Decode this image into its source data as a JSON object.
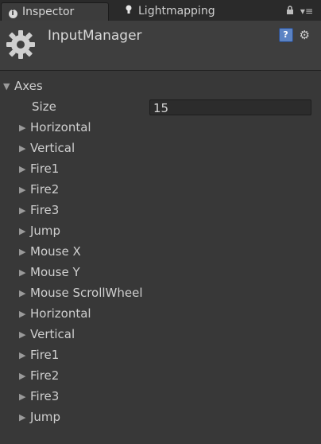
{
  "tabs": [
    {
      "label": "Inspector",
      "icon": "info-icon"
    },
    {
      "label": "Lightmapping",
      "icon": "lightbulb-icon"
    }
  ],
  "header": {
    "title": "InputManager"
  },
  "axes": {
    "label": "Axes",
    "size_label": "Size",
    "size_value": "15",
    "items": [
      "Horizontal",
      "Vertical",
      "Fire1",
      "Fire2",
      "Fire3",
      "Jump",
      "Mouse X",
      "Mouse Y",
      "Mouse ScrollWheel",
      "Horizontal",
      "Vertical",
      "Fire1",
      "Fire2",
      "Fire3",
      "Jump"
    ]
  },
  "colors": {
    "panel_bg": "#383838",
    "tab_bg": "#2a2a2a",
    "help_icon": "#5b83c4"
  }
}
